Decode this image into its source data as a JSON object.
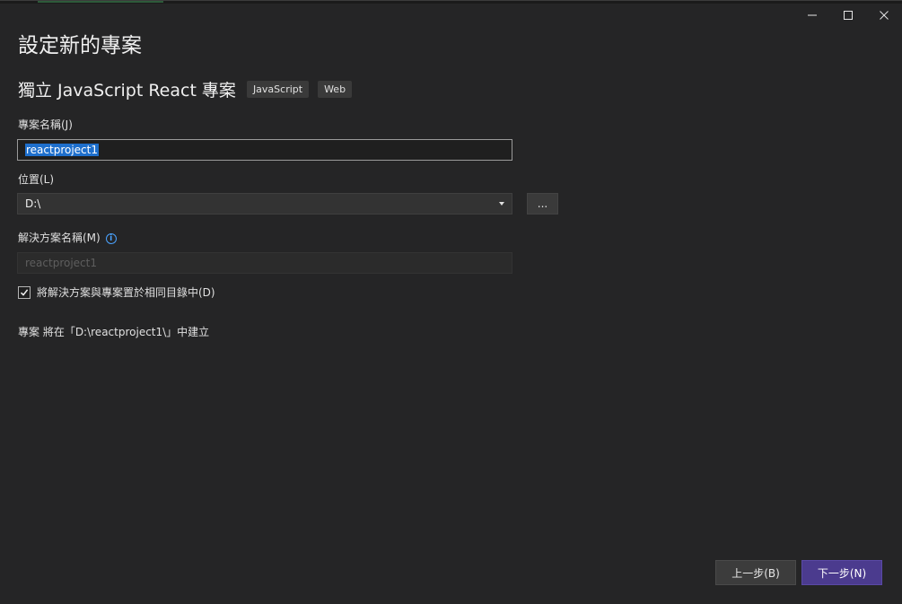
{
  "window": {
    "title": "設定新的專案",
    "caption_buttons": {
      "minimize_icon": "minimize-icon",
      "maximize_icon": "maximize-icon",
      "close_icon": "close-icon"
    }
  },
  "template": {
    "name": "獨立 JavaScript React 專案",
    "tags": [
      "JavaScript",
      "Web"
    ]
  },
  "form": {
    "project_name": {
      "label": "專案名稱(J)",
      "value": "reactproject1"
    },
    "location": {
      "label": "位置(L)",
      "value": "D:\\",
      "browse_label": "..."
    },
    "solution_name": {
      "label": "解決方案名稱(M)",
      "placeholder": "reactproject1",
      "info_icon": "info-icon"
    },
    "same_directory": {
      "label": "將解決方案與專案置於相同目錄中(D)",
      "checked": true
    }
  },
  "summary": "專案 將在「D:\\reactproject1\\」中建立",
  "footer": {
    "back_label": "上一步(B)",
    "next_label": "下一步(N)"
  },
  "colors": {
    "background": "#252526",
    "selection": "#1e6fcc",
    "primary_button": "#4b3b8e",
    "info": "#4aa3ff"
  }
}
